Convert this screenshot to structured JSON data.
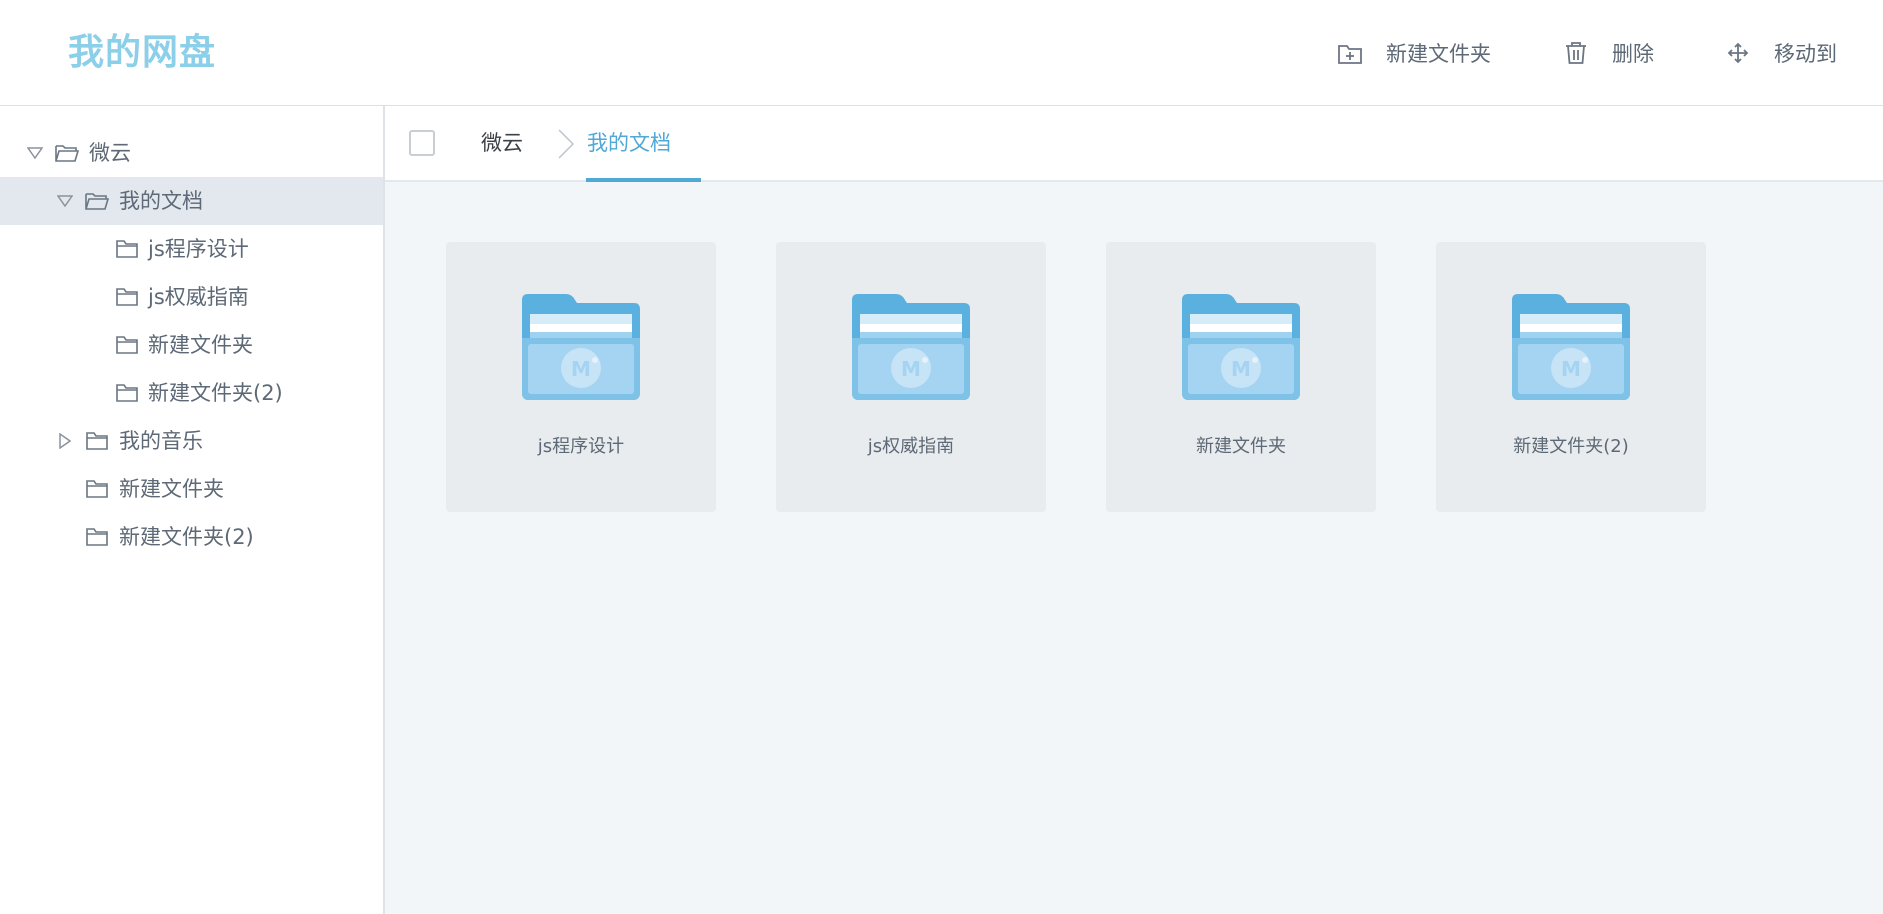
{
  "app": {
    "logo": "我的网盘"
  },
  "toolbar": {
    "new_folder_label": "新建文件夹",
    "delete_label": "删除",
    "move_label": "移动到"
  },
  "sidebar": {
    "tree": [
      {
        "label": "微云",
        "expanded": true,
        "selected": false
      },
      {
        "label": "我的文档",
        "expanded": true,
        "selected": true
      },
      {
        "label": "js程序设计",
        "selected": false
      },
      {
        "label": "js权威指南",
        "selected": false
      },
      {
        "label": "新建文件夹",
        "selected": false
      },
      {
        "label": "新建文件夹(2)",
        "selected": false
      },
      {
        "label": "我的音乐",
        "expanded": false,
        "selected": false
      },
      {
        "label": "新建文件夹",
        "selected": false
      },
      {
        "label": "新建文件夹(2)",
        "selected": false
      }
    ]
  },
  "breadcrumb": {
    "root": "微云",
    "current": "我的文档"
  },
  "files": [
    {
      "name": "js程序设计",
      "icon": "folder-icon"
    },
    {
      "name": "js权威指南",
      "icon": "folder-icon"
    },
    {
      "name": "新建文件夹",
      "icon": "folder-icon"
    },
    {
      "name": "新建文件夹(2)",
      "icon": "folder-icon"
    }
  ],
  "colors": {
    "accent": "#4fa8d6",
    "logo": "#8ccfe8",
    "selected_row": "#e2e8ed",
    "card_bg": "#e9ecee"
  }
}
